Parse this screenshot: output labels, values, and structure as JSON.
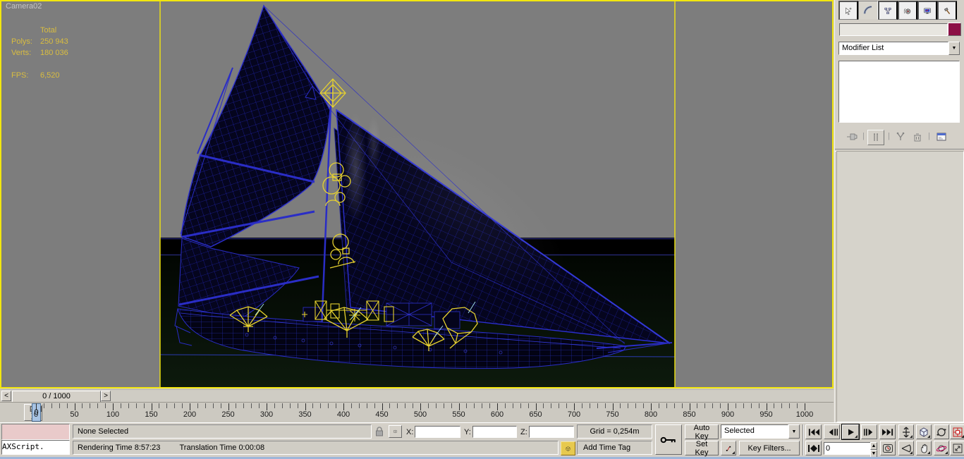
{
  "colors": {
    "safe_frame_yellow": "#f2e60e",
    "viewport_gray": "#7d7d7d",
    "wireframe_blue": "#2a2dc6",
    "helper_yellow": "#e6d12f",
    "object_color_swatch": "#8c1046",
    "stats_text_yellow": "#d9bd40",
    "panel_gray": "#d4d0c8"
  },
  "viewport": {
    "label": "Camera02",
    "stats": {
      "total_header": "Total",
      "polys_label": "Polys:",
      "polys_value": "250 943",
      "verts_label": "Verts:",
      "verts_value": "180 036",
      "fps_label": "FPS:",
      "fps_value": "6,520"
    }
  },
  "command_panel": {
    "tabs": [
      {
        "label": "Create",
        "icon": "create-arrow-icon",
        "active": false
      },
      {
        "label": "Modify",
        "icon": "modify-curve-icon",
        "active": true
      },
      {
        "label": "Hierarchy",
        "icon": "hierarchy-tree-icon",
        "active": false
      },
      {
        "label": "Motion",
        "icon": "motion-wheel-icon",
        "active": false
      },
      {
        "label": "Display",
        "icon": "display-monitor-icon",
        "active": false
      },
      {
        "label": "Utilities",
        "icon": "utilities-hammer-icon",
        "active": false
      }
    ],
    "object_name_value": "",
    "modifier_list_label": "Modifier List",
    "modifier_stack_items": []
  },
  "timeline": {
    "slider_value": "0 / 1000",
    "current_frame": "0",
    "start": 0,
    "end": 1000,
    "minor_step": 10,
    "major_step": 50
  },
  "status_bar": {
    "maxscript_output": "",
    "maxscript_input": "AXScript.",
    "prompt_line": "None Selected",
    "rendering_time": "Rendering Time  8:57:23",
    "translation_time": "Translation Time  0:00:08",
    "x_label": "X:",
    "y_label": "Y:",
    "z_label": "Z:",
    "x_value": "",
    "y_value": "",
    "z_value": "",
    "grid_display": "Grid = 0,254m",
    "add_time_tag": "Add Time Tag",
    "auto_key_label": "Auto Key",
    "set_key_label": "Set Key",
    "key_mode_selected": "Selected",
    "key_filters_label": "Key Filters...",
    "frame_value": "0"
  },
  "glyphs": {
    "prev": "<",
    "next": ">",
    "dropdown": "▼",
    "spin_up": "▲",
    "spin_down": "▼"
  }
}
